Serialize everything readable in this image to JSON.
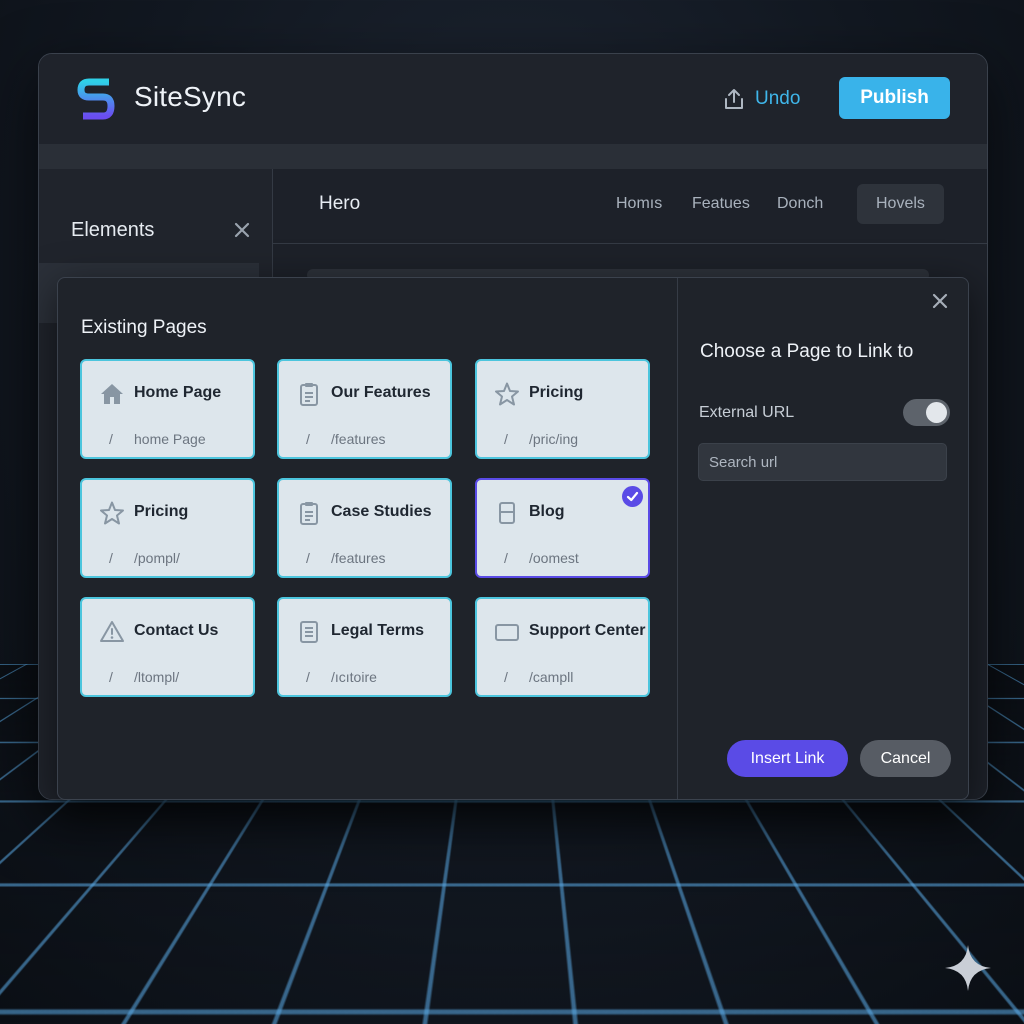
{
  "app": {
    "brand": "SiteSync",
    "undo_label": "Undo",
    "publish_label": "Publish"
  },
  "sidebar": {
    "title": "Elements"
  },
  "canvas": {
    "section_label": "Hero",
    "tabs": [
      {
        "label": "Homıs"
      },
      {
        "label": "Featues"
      },
      {
        "label": "Donch"
      },
      {
        "label": "Hovels",
        "active": true
      }
    ]
  },
  "modal": {
    "section_title": "Existing Pages",
    "right_title": "Choose a Page to Link to",
    "external_url_label": "External URL",
    "external_url_enabled": true,
    "search_placeholder": "Search url",
    "insert_label": "Insert Link",
    "cancel_label": "Cancel",
    "slash": "/",
    "pages": [
      {
        "title": "Home Page",
        "path": "home Page",
        "icon": "home-icon"
      },
      {
        "title": "Our Features",
        "path": "/features",
        "icon": "clipboard-icon"
      },
      {
        "title": "Pricing",
        "path": "/pric/ing",
        "icon": "star-icon"
      },
      {
        "title": "Pricing",
        "path": "/pompl/",
        "icon": "star-icon"
      },
      {
        "title": "Case Studies",
        "path": "/features",
        "icon": "clipboard-icon"
      },
      {
        "title": "Blog",
        "path": "/oomest",
        "icon": "blog-icon",
        "selected": true
      },
      {
        "title": "Contact Us",
        "path": "/ltompl/",
        "icon": "warning-icon"
      },
      {
        "title": "Legal Terms",
        "path": "/ıcıtoire",
        "icon": "document-icon"
      },
      {
        "title": "Support Center",
        "path": "/campll",
        "icon": "monitor-icon"
      }
    ]
  },
  "colors": {
    "accent_cyan": "#39b3ea",
    "accent_purple": "#5a4be6",
    "card_border": "#4cc5dd",
    "card_bg": "#dde6ec"
  }
}
